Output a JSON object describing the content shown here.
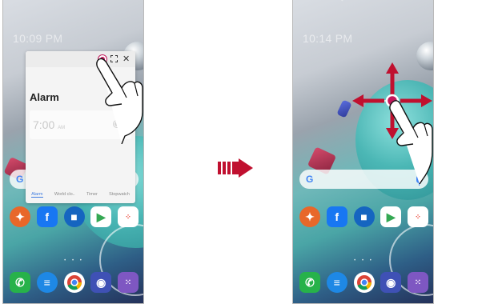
{
  "left_screen": {
    "clock": "10:09 PM",
    "popup": {
      "title": "Alarm",
      "add_symbol": "+",
      "alarm_time": "7:00",
      "alarm_ampm": "AM",
      "alarm_days": "",
      "close_symbol": "✕",
      "tabs": [
        "Alarm",
        "World clo..",
        "Timer",
        "Stopwatch"
      ]
    },
    "search_logo": "G"
  },
  "right_screen": {
    "clock": "10:14 PM",
    "search_logo": "G"
  },
  "colors": {
    "accent_magenta": "#c2185b",
    "arrow_red": "#c0102f"
  },
  "icons": {
    "apps": [
      "vpn-shield-icon",
      "facebook-icon",
      "video-camera-icon",
      "play-store-icon",
      "app-folder-icon"
    ],
    "dock": [
      "phone-icon",
      "messages-icon",
      "chrome-icon",
      "camera-icon",
      "all-apps-icon"
    ]
  }
}
